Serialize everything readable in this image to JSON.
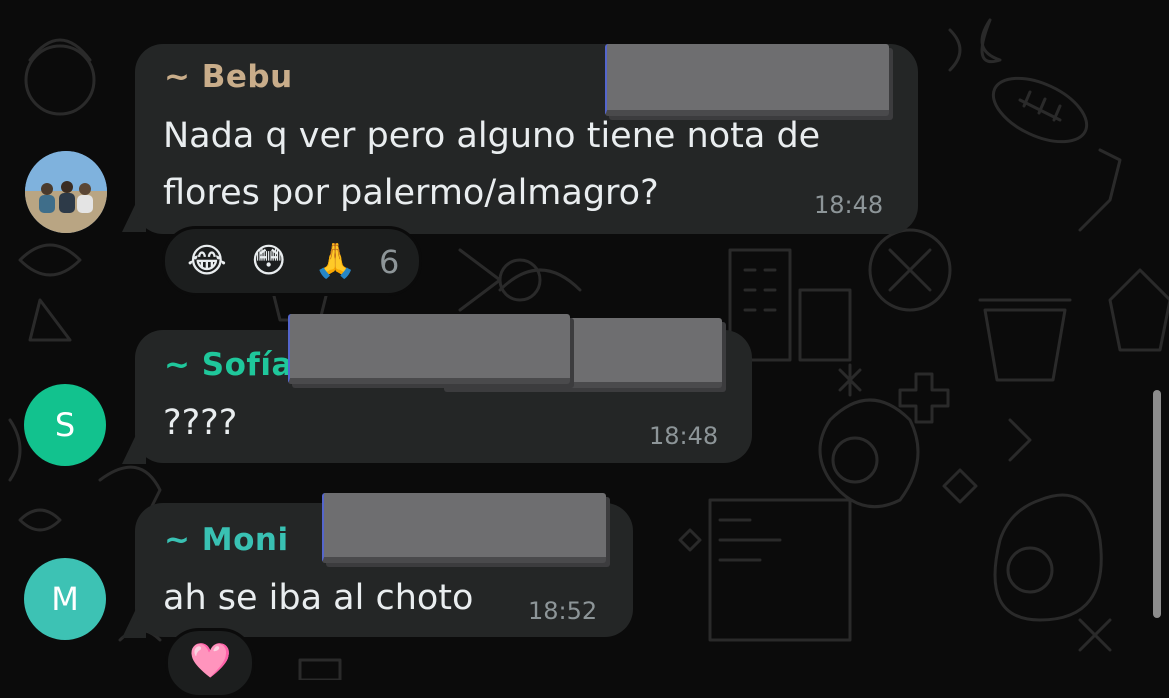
{
  "messages": [
    {
      "sender": "~ Bebu",
      "sender_color": "#c9ad8a",
      "text_lines": [
        "Nada q ver pero alguno tiene nota de",
        "flores por palermo/almagro?"
      ],
      "time": "18:48",
      "avatar_icon": "group-photo-avatar",
      "reactions": {
        "emojis": [
          "😂",
          "😳",
          "🙏"
        ],
        "count": "6"
      }
    },
    {
      "sender": "~ Sofía",
      "sender_color": "#1fc79b",
      "text_lines": [
        "????"
      ],
      "time": "18:48",
      "avatar_letter": "S",
      "avatar_color": "#12c28e"
    },
    {
      "sender": "~ Moni",
      "sender_color": "#39c1b3",
      "text_lines": [
        "ah se iba al choto"
      ],
      "time": "18:52",
      "avatar_letter": "M",
      "avatar_color": "#3dc2b4",
      "reactions": {
        "emojis": [
          "🩷"
        ]
      }
    }
  ],
  "colors": {
    "bubble": "#242626",
    "background": "#0b0b0b",
    "timestamp": "#8d9598"
  }
}
